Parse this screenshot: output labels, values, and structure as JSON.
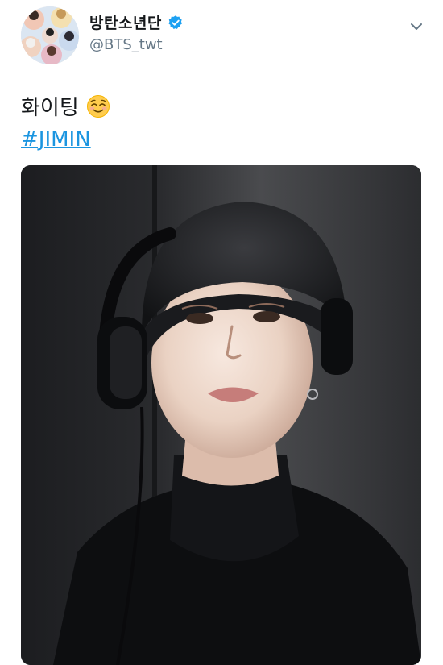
{
  "tweet": {
    "display_name": "방탄소년단",
    "handle": "@BTS_twt",
    "verified": true,
    "text": "화이팅",
    "emoji": "relieved-smiling-face",
    "hashtag": "#JIMIN"
  },
  "icons": {
    "verified": "verified-badge-icon",
    "menu": "chevron-down-icon"
  },
  "colors": {
    "link": "#1b95e0",
    "verified": "#1da1f2",
    "secondary_text": "#657786"
  }
}
